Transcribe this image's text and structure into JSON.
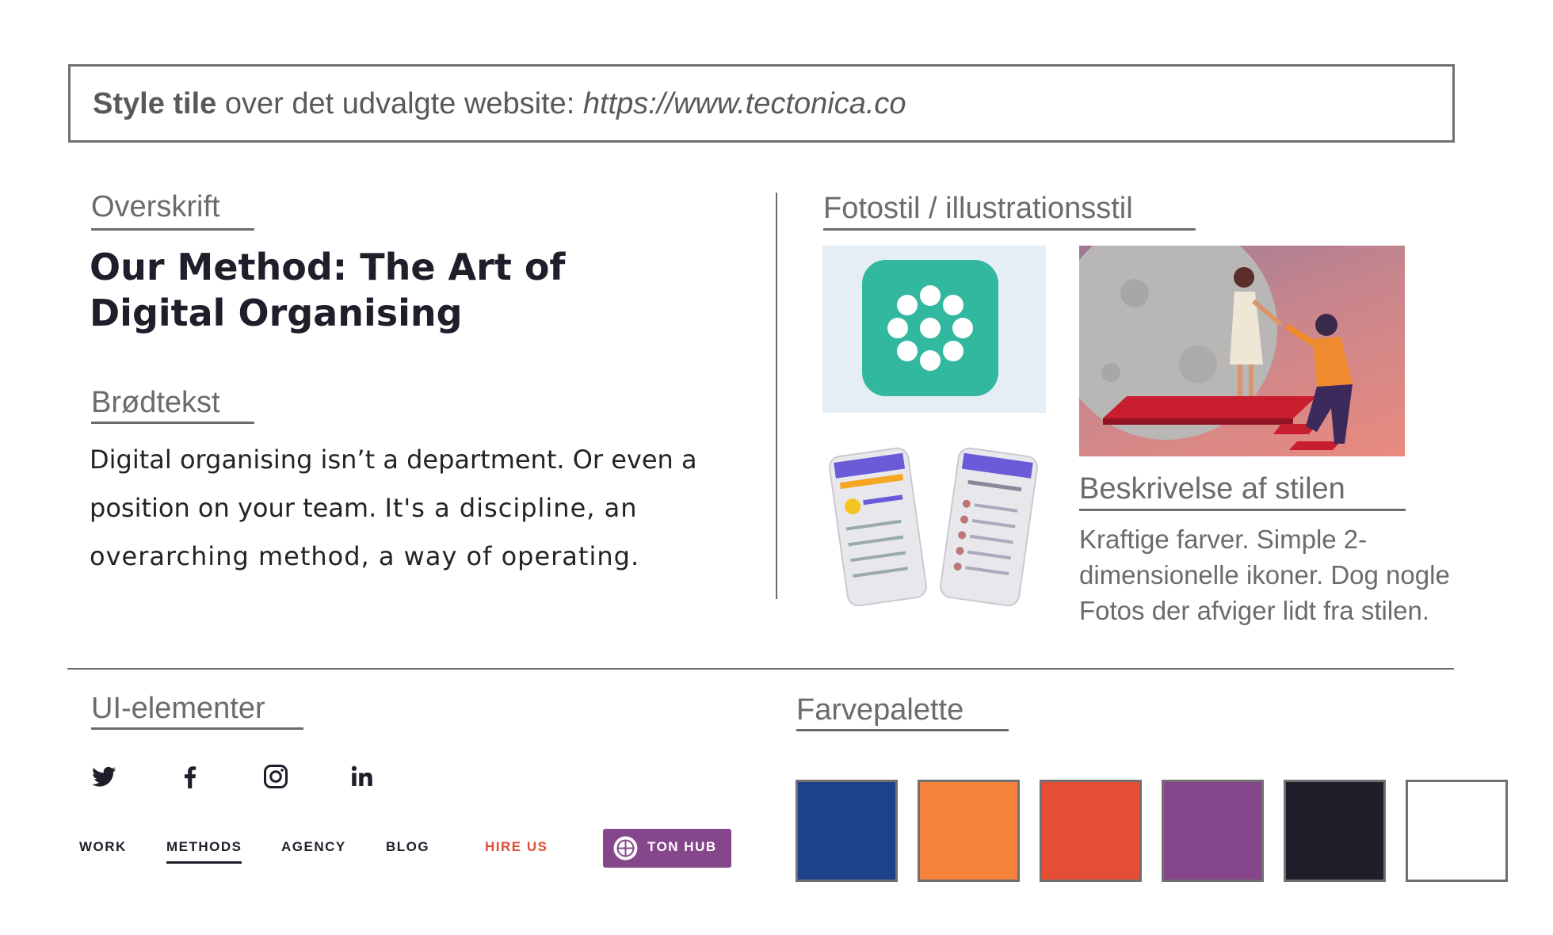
{
  "title": {
    "bold": "Style tile",
    "text": " over det udvalgte website: ",
    "url": "https://www.tectonica.co"
  },
  "sections": {
    "heading_label": "Overskrift",
    "body_label": "Brødtekst",
    "photo_label": "Fotostil / illustrationsstil",
    "description_label": "Beskrivelse af stilen",
    "ui_label": "UI-elementer",
    "palette_label": "Farvepalette"
  },
  "heading_sample": {
    "line1": "Our Method: The Art of",
    "line2": "Digital Organising"
  },
  "body_sample": {
    "part1": "Digital organising isn’t a department. Or even a position on your team. ",
    "part2": "It's a discipline, an overarching method, a way of operating."
  },
  "description": {
    "text": "Kraftige farver. Simple 2-dimensionelle ikoner. Dog nogle Fotos der afviger lidt fra stilen."
  },
  "social_icons": [
    "twitter-icon",
    "facebook-icon",
    "instagram-icon",
    "linkedin-icon"
  ],
  "nav": {
    "work": "WORK",
    "methods": "METHODS",
    "agency": "AGENCY",
    "blog": "BLOG",
    "hire": "HIRE US",
    "tonhub": "TON HUB"
  },
  "palette": [
    "#1d4289",
    "#f5823b",
    "#e54d35",
    "#86468b",
    "#1e1f2b",
    "#ffffff"
  ],
  "accent_colors": {
    "hire_red": "#e24b35",
    "tonhub_purple": "#86468b",
    "app_teal": "#33b8a0"
  }
}
